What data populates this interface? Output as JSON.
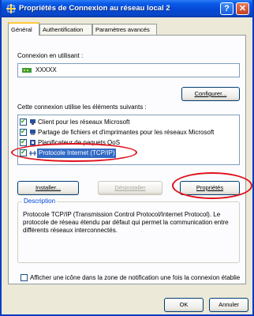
{
  "window": {
    "title": "Propriétés de Connexion au réseau local 2",
    "help_glyph": "?",
    "close_glyph": "✕"
  },
  "tabs": [
    {
      "label": "Général",
      "active": true
    },
    {
      "label": "Authentification",
      "active": false
    },
    {
      "label": "Paramètres avancés",
      "active": false
    }
  ],
  "general": {
    "connect_using_label": "Connexion en utilisant :",
    "adapter_name": "XXXXX",
    "configure_label": "Configurer...",
    "items_label": "Cette connexion utilise les éléments suivants :",
    "items": [
      {
        "label": "Client pour les réseaux Microsoft",
        "checked": true,
        "icon": "network-client-icon"
      },
      {
        "label": "Partage de fichiers et d'imprimantes pour les réseaux Microsoft",
        "checked": true,
        "icon": "printer-share-icon"
      },
      {
        "label": "Planificateur de paquets QoS",
        "checked": true,
        "icon": "qos-scheduler-icon"
      },
      {
        "label": "Protocole Internet (TCP/IP)",
        "checked": true,
        "selected": true,
        "icon": "protocol-icon"
      }
    ],
    "install_label": "Installer...",
    "uninstall_label": "Désinstaller",
    "properties_label": "Propriétés",
    "description_title": "Description",
    "description_text": "Protocole TCP/IP (Transmission Control Protocol/Internet Protocol). Le protocole de réseau étendu par défaut qui permet la communication entre différents réseaux interconnectés.",
    "notify_label": "Afficher une icône dans la zone de notification une fois la connexion établie",
    "notify_checked": false
  },
  "footer": {
    "ok_label": "OK",
    "cancel_label": "Annuler"
  },
  "colors": {
    "titlebar": "#0548d4",
    "selection": "#316ac5",
    "annotation": "#e0101a",
    "description_title": "#0046d5"
  }
}
